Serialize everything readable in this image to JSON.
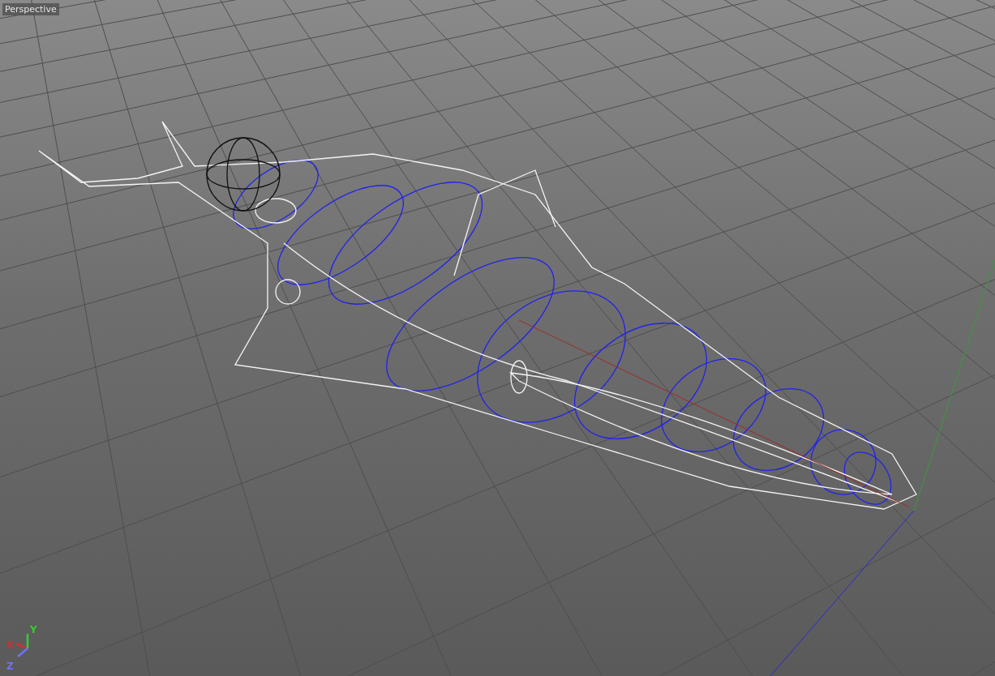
{
  "viewport": {
    "label": "Perspective"
  },
  "axis_gizmo": [
    {
      "label": "X",
      "color": "#d03030"
    },
    {
      "label": "Y",
      "color": "#30d030"
    },
    {
      "label": "Z",
      "color": "#7070ff"
    }
  ]
}
